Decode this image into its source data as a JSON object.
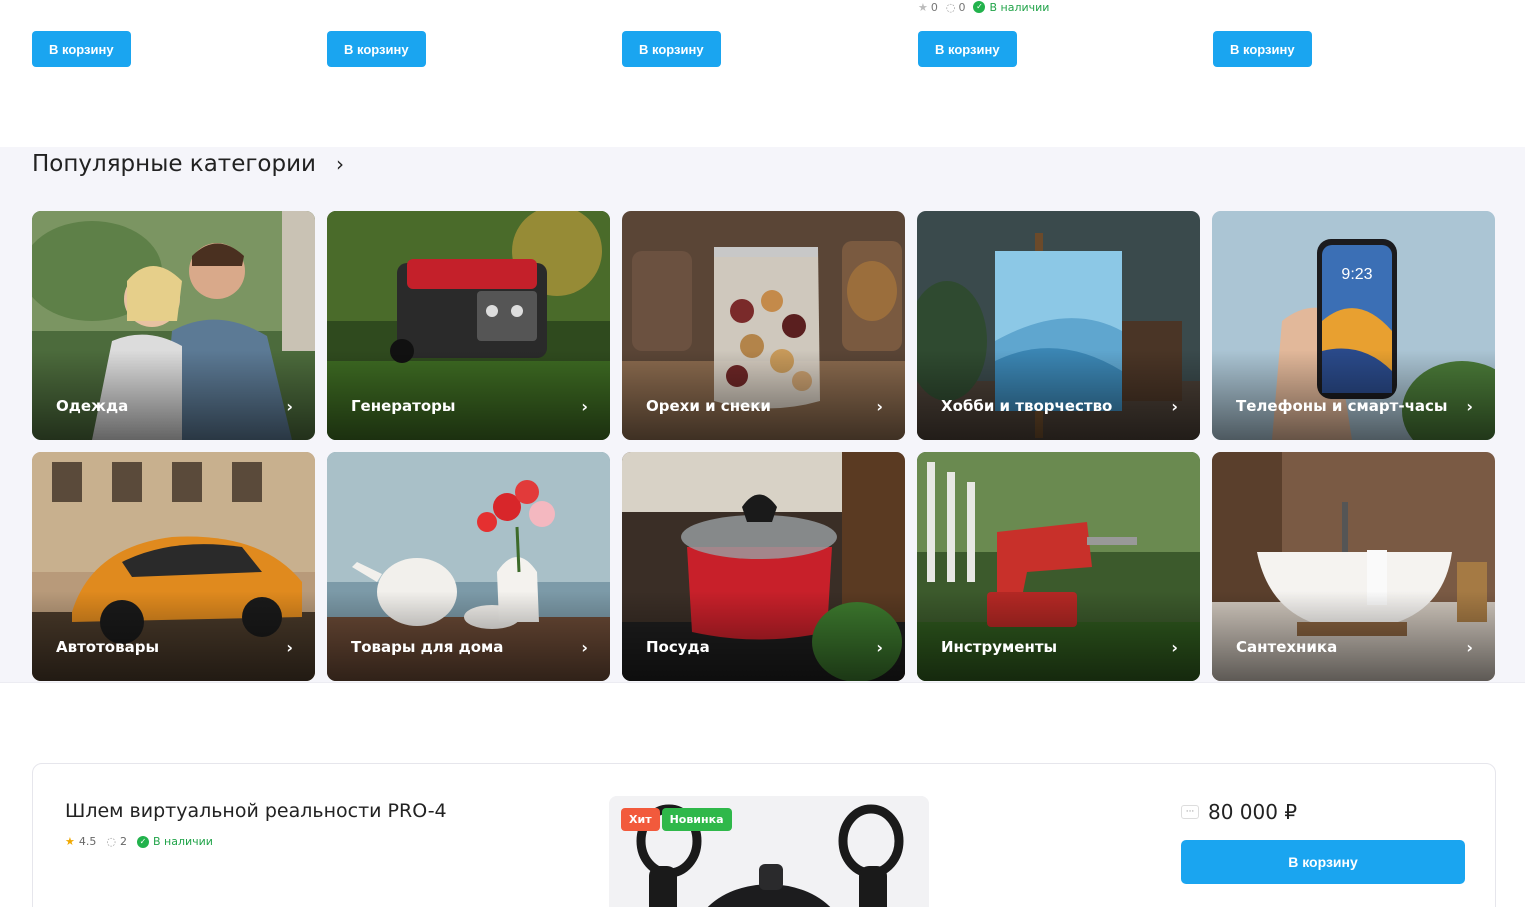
{
  "top_products": {
    "cart_label": "В корзину",
    "product4_meta": {
      "rating": "0",
      "comments": "0",
      "stock": "В наличии"
    }
  },
  "categories": {
    "title": "Популярные категории",
    "items": [
      {
        "label": "Одежда",
        "icon": "clothing-image"
      },
      {
        "label": "Генераторы",
        "icon": "generator-image"
      },
      {
        "label": "Орехи и снеки",
        "icon": "nuts-image"
      },
      {
        "label": "Хобби и творчество",
        "icon": "canvas-image"
      },
      {
        "label": "Телефоны и смарт-часы",
        "icon": "phone-image"
      },
      {
        "label": "Автотовары",
        "icon": "car-image"
      },
      {
        "label": "Товары для дома",
        "icon": "teapot-image"
      },
      {
        "label": "Посуда",
        "icon": "pot-image"
      },
      {
        "label": "Инструменты",
        "icon": "drill-image"
      },
      {
        "label": "Сантехника",
        "icon": "bathtub-image"
      }
    ]
  },
  "product": {
    "title": "Шлем виртуальной реальности PRO-4",
    "rating": "4.5",
    "comments": "2",
    "stock": "В наличии",
    "badge_hit": "Хит",
    "badge_new": "Новинка",
    "price": "80 000 ₽",
    "price_dots": "···",
    "cart_label": "В корзину"
  },
  "colors": {
    "accent": "#1aa5f0",
    "stock": "#22b24c",
    "hit": "#f25a3c",
    "new": "#2fb84a",
    "section_bg": "#f5f5fa"
  }
}
